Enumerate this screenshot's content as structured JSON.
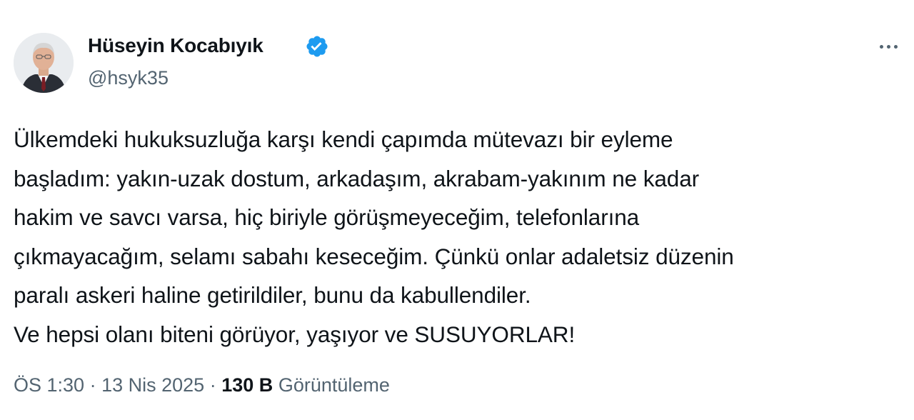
{
  "author": {
    "display_name": "Hüseyin Kocabıyık",
    "handle": "@hsyk35",
    "verified": true,
    "verified_color": "#1d9bf0"
  },
  "tweet": {
    "lines": [
      "Ülkemdeki hukuksuzluğa karşı kendi çapımda mütevazı bir eyleme",
      "başladım: yakın-uzak dostum, arkadaşım, akrabam-yakınım ne kadar",
      "hakim ve savcı varsa, hiç biriyle görüşmeyeceğim, telefonlarına",
      "çıkmayacağım, selamı sabahı keseceğim. Çünkü onlar adaletsiz düzenin",
      "paralı askeri haline getirildiler, bunu da kabullendiler.",
      "Ve hepsi olanı biteni görüyor, yaşıyor ve SUSUYORLAR!"
    ]
  },
  "meta": {
    "time": "ÖS 1:30",
    "separator": "·",
    "date": "13 Nis 2025",
    "views_count": "130 B",
    "views_label": "Görüntüleme"
  },
  "icons": {
    "more": "more-options-icon",
    "verified": "verified-badge-icon"
  }
}
